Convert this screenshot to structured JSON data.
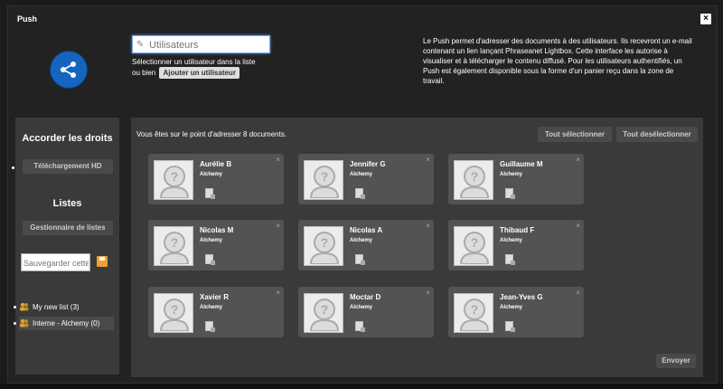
{
  "window": {
    "title": "Push",
    "close_label": "×"
  },
  "search": {
    "placeholder": "Utilisateurs"
  },
  "hint": {
    "line1": "Sélectionner un utilisateur dans la liste",
    "line2_prefix": "ou bien",
    "add_user_label": "Ajouter un utilisateur"
  },
  "info_text": "Le Push permet d'adresser des documents à des utilisateurs. Ils recevront un e-mail contenant un lien lançant Phraseanet Lightbox. Cette interface les autorise à visualiser et à télécharger le contenu diffusé. Pour les utilisateurs authentifiés, un Push est également disponible sous la forme d'un panier reçu dans la zone de travail.",
  "left_panel": {
    "rights_heading": "Accorder les droits",
    "hd_download_label": "Téléchargement HD",
    "lists_heading": "Listes",
    "list_manager_label": "Gestionnaire de listes",
    "save_placeholder": "Sauvegarder cette liste",
    "lists": [
      {
        "label": "My new list (3)"
      },
      {
        "label": "Interne - Alchemy (0)"
      }
    ]
  },
  "main": {
    "doc_info": "Vous êtes sur le point d'adresser 8 documents.",
    "select_all_label": "Tout sélectionner",
    "deselect_all_label": "Tout desélectionner",
    "send_label": "Envoyer",
    "users": [
      {
        "name": "Aurélie B",
        "company": "Alchemy"
      },
      {
        "name": "Jennifer G",
        "company": "Alchemy"
      },
      {
        "name": "Guillaume M",
        "company": "Alchemy"
      },
      {
        "name": "Nicolas M",
        "company": "Alchemy"
      },
      {
        "name": "Nicolas A",
        "company": "Alchemy"
      },
      {
        "name": "Thibaud F",
        "company": "Alchemy"
      },
      {
        "name": "Xavier R",
        "company": "Alchemy"
      },
      {
        "name": "Moctar D",
        "company": "Alchemy"
      },
      {
        "name": "Jean-Yves G",
        "company": "Alchemy"
      }
    ]
  },
  "colors": {
    "accent": "#1565c0",
    "panel": "#3a3a3a",
    "card": "#535353",
    "floppy": "#f0a030"
  }
}
